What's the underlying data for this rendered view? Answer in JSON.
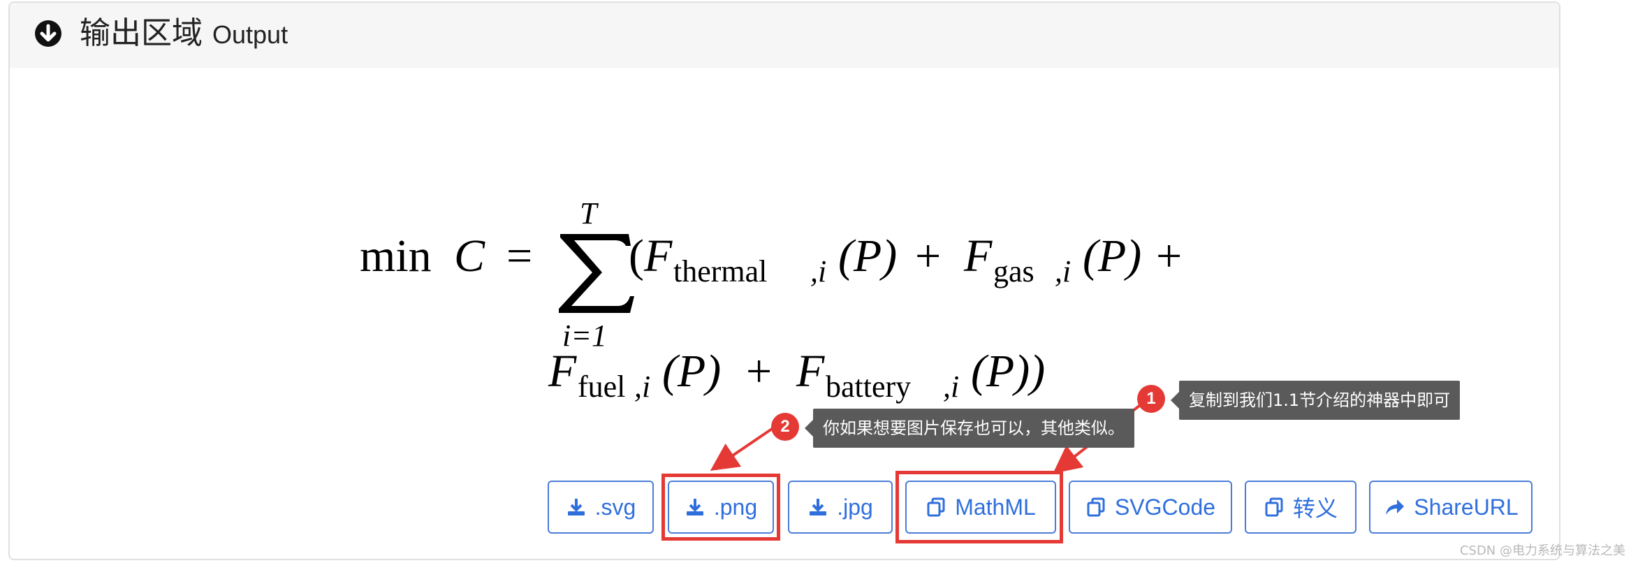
{
  "header": {
    "title_cn": "输出区域",
    "title_en": "Output",
    "icon": "arrow-down-circle-icon"
  },
  "formula": {
    "min": "min",
    "C": "C",
    "eq": "=",
    "sum_upper": "T",
    "sum_lower": "i=1",
    "line1": {
      "open": "(",
      "F": "F",
      "sub1": "thermal",
      "comma_i": ",i",
      "P": "(P)",
      "plus": "+",
      "F2": "F",
      "sub2": "gas",
      "comma_i2": ",i",
      "P2": "(P)",
      "plus2": "+"
    },
    "line2": {
      "F": "F",
      "sub1": "fuel",
      "comma_i": ",i",
      "P": "(P)",
      "plus": "+",
      "F2": "F",
      "sub2": "battery",
      "comma_i2": ",i",
      "P2": "(P))"
    }
  },
  "buttons": [
    {
      "label": ".svg",
      "icon": "download-icon"
    },
    {
      "label": ".png",
      "icon": "download-icon"
    },
    {
      "label": ".jpg",
      "icon": "download-icon"
    },
    {
      "label": "MathML",
      "icon": "copy-icon"
    },
    {
      "label": "SVGCode",
      "icon": "copy-icon"
    },
    {
      "label": "转义",
      "icon": "copy-icon"
    },
    {
      "label": "ShareURL",
      "icon": "share-icon"
    }
  ],
  "annotations": [
    {
      "badge": "1",
      "text": "复制到我们1.1节介绍的神器中即可"
    },
    {
      "badge": "2",
      "text": "你如果想要图片保存也可以，其他类似。"
    }
  ],
  "colors": {
    "accent": "#2f6fdc",
    "highlight": "#e53935",
    "tooltip": "#5a5a5a"
  },
  "watermark": "CSDN @电力系统与算法之美"
}
